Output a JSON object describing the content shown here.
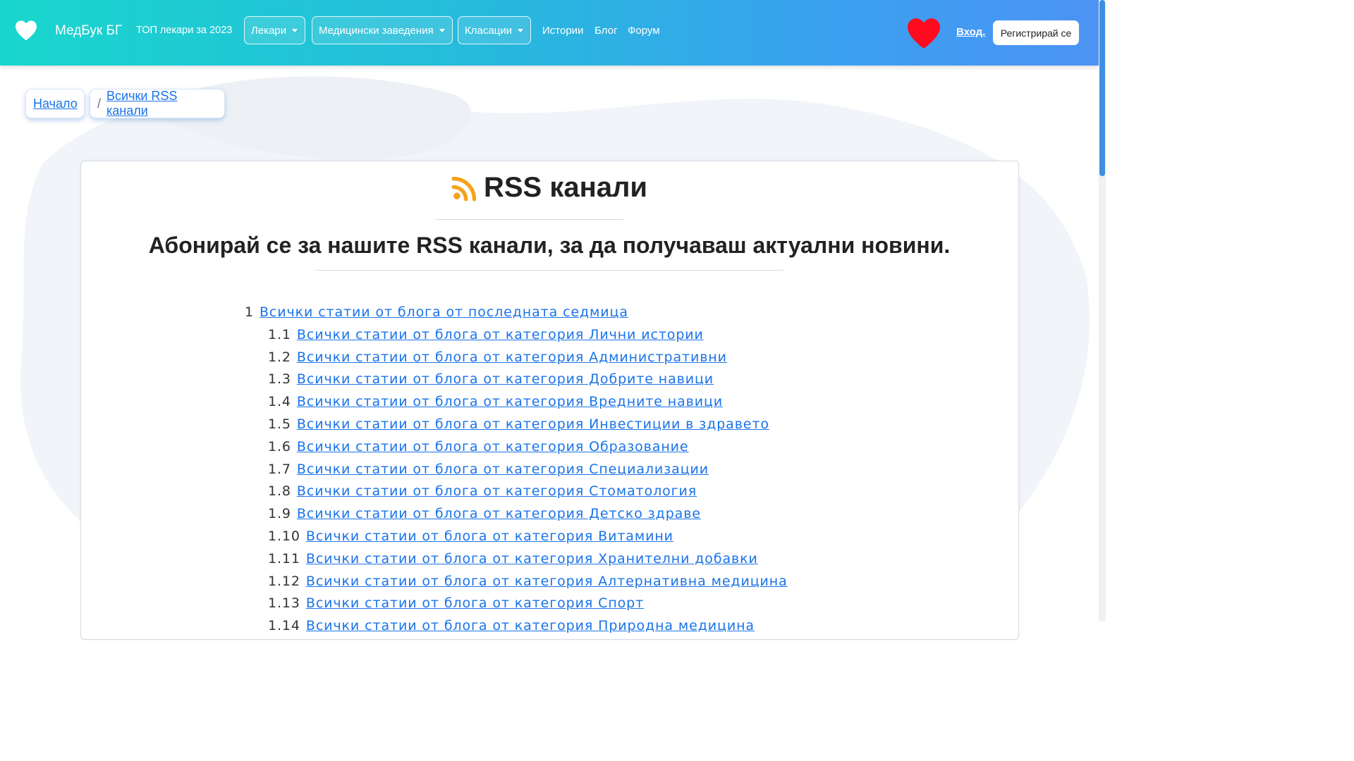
{
  "header": {
    "brand": "МедБук БГ",
    "top_doctors": "ТОП лекари за 2023",
    "menu_doctors": "Лекари",
    "menu_facilities": "Медицински заведения",
    "menu_rankings": "Класации",
    "stories": "Истории",
    "blog": "Блог",
    "forum": "Форум",
    "login": "Вход.",
    "register": "Регистрирай се"
  },
  "breadcrumb": {
    "home": "Начало",
    "separator": "/",
    "current": "Всички RSS канали"
  },
  "main": {
    "title": "RSS канали",
    "subtitle": "Абонирай се за нашите RSS канали, за да получаваш актуални новини."
  },
  "feeds": {
    "root": {
      "num": "1",
      "label": "Всички статии от блога от последната седмица"
    },
    "items": [
      {
        "num": "1.1",
        "label": "Всички статии от блога от категория Лични истории"
      },
      {
        "num": "1.2",
        "label": "Всички статии от блога от категория Административни"
      },
      {
        "num": "1.3",
        "label": "Всички статии от блога от категория Добрите навици"
      },
      {
        "num": "1.4",
        "label": "Всички статии от блога от категория Вредните навици"
      },
      {
        "num": "1.5",
        "label": "Всички статии от блога от категория Инвестиции в здравето"
      },
      {
        "num": "1.6",
        "label": "Всички статии от блога от категория Образование"
      },
      {
        "num": "1.7",
        "label": "Всички статии от блога от категория Специализации"
      },
      {
        "num": "1.8",
        "label": "Всички статии от блога от категория Стоматология"
      },
      {
        "num": "1.9",
        "label": "Всички статии от блога от категория Детско здраве"
      },
      {
        "num": "1.10",
        "label": "Всички статии от блога от категория Витамини"
      },
      {
        "num": "1.11",
        "label": "Всички статии от блога от категория Хранителни добавки"
      },
      {
        "num": "1.12",
        "label": "Всички статии от блога от категория Алтернативна медицина"
      },
      {
        "num": "1.13",
        "label": "Всички статии от блога от категория Спорт"
      },
      {
        "num": "1.14",
        "label": "Всички статии от блога от категория Природна медицина"
      }
    ]
  },
  "icons": {
    "brand": "heart-icon",
    "favorites": "heart-icon",
    "rss": "rss-icon",
    "dropdown": "caret-down-icon"
  },
  "colors": {
    "nav_gradient_start": "#19d6cd",
    "nav_gradient_end": "#4c93f4",
    "link": "#1a73e8",
    "heart": "#ff0a1e",
    "rss": "#f7a21b"
  }
}
